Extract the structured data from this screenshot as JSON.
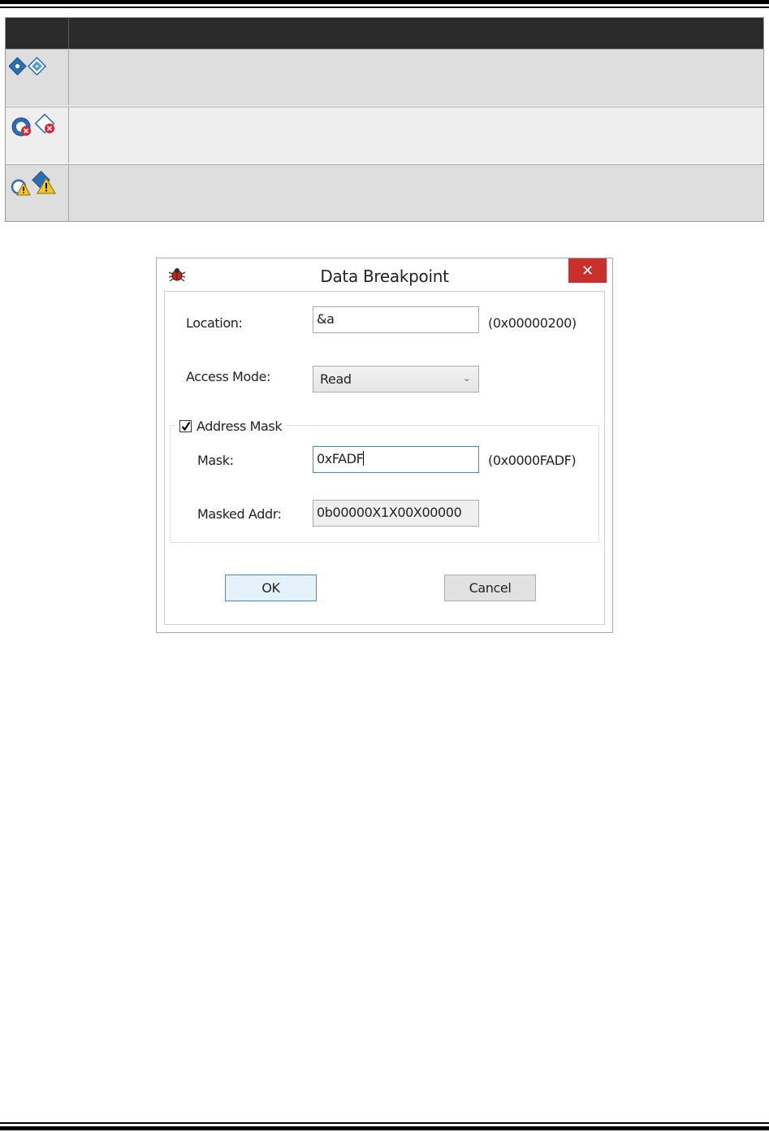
{
  "legend": {
    "rows": [
      {
        "icons": [
          "breakpoint-enabled-icon",
          "data-breakpoint-enabled-icon"
        ],
        "description": ""
      },
      {
        "icons": [
          "breakpoint-error-icon",
          "data-breakpoint-error-icon"
        ],
        "description": ""
      },
      {
        "icons": [
          "breakpoint-warning-icon",
          "data-breakpoint-warning-icon"
        ],
        "description": ""
      }
    ]
  },
  "dialog": {
    "title": "Data Breakpoint",
    "close_label": "✕",
    "location": {
      "label": "Location:",
      "value": "&a",
      "resolved": "(0x00000200)"
    },
    "access_mode": {
      "label": "Access Mode:",
      "selected": "Read"
    },
    "address_mask": {
      "label": "Address Mask",
      "checked": true,
      "mask": {
        "label": "Mask:",
        "value": "0xFADF",
        "resolved": "(0x0000FADF)"
      },
      "masked_addr": {
        "label": "Masked Addr:",
        "value": "0b00000X1X00X00000"
      }
    },
    "ok_label": "OK",
    "cancel_label": "Cancel"
  },
  "colors": {
    "close_button": "#c9302c",
    "focus_border": "#3c8fd6",
    "header_bar": "#2b2b2b",
    "icon_blue": "#2a6fb5",
    "icon_error": "#e0242f",
    "icon_warning": "#f3c623"
  }
}
